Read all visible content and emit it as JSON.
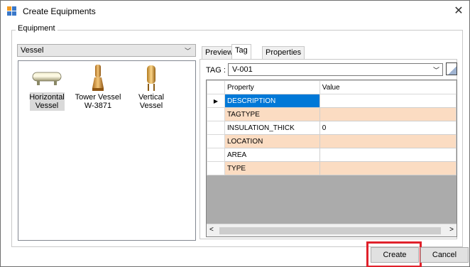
{
  "window": {
    "title": "Create Equipments",
    "close_glyph": "✕"
  },
  "group": {
    "legend": "Equipment"
  },
  "equipment_type": {
    "selected": "Vessel"
  },
  "equipment_items": [
    {
      "label_line1": "Horizontal",
      "label_line2": "Vessel",
      "icon": "horizontal-vessel-icon",
      "selected": true
    },
    {
      "label_line1": "Tower Vessel",
      "label_line2": "W-3871",
      "icon": "tower-vessel-icon",
      "selected": false
    },
    {
      "label_line1": "Vertical Vessel",
      "label_line2": "",
      "icon": "vertical-vessel-icon",
      "selected": false
    }
  ],
  "tabs": [
    {
      "label": "Preview",
      "active": false
    },
    {
      "label": "Tag",
      "active": true
    },
    {
      "label": "Properties",
      "active": false
    }
  ],
  "tag": {
    "label": "TAG :",
    "value": "V-001"
  },
  "grid": {
    "headers": [
      "Property",
      "Value"
    ],
    "rows": [
      {
        "property": "DESCRIPTION",
        "value": ""
      },
      {
        "property": "TAGTYPE",
        "value": ""
      },
      {
        "property": "INSULATION_THICK",
        "value": "0"
      },
      {
        "property": "LOCATION",
        "value": ""
      },
      {
        "property": "AREA",
        "value": ""
      },
      {
        "property": "TYPE",
        "value": ""
      }
    ],
    "current_row_marker": "▶"
  },
  "buttons": {
    "create": "Create",
    "cancel": "Cancel"
  },
  "colors": {
    "selection_blue": "#0078d7",
    "alt_row_peach": "#fbdcc2",
    "highlight_red": "#e0212b"
  }
}
